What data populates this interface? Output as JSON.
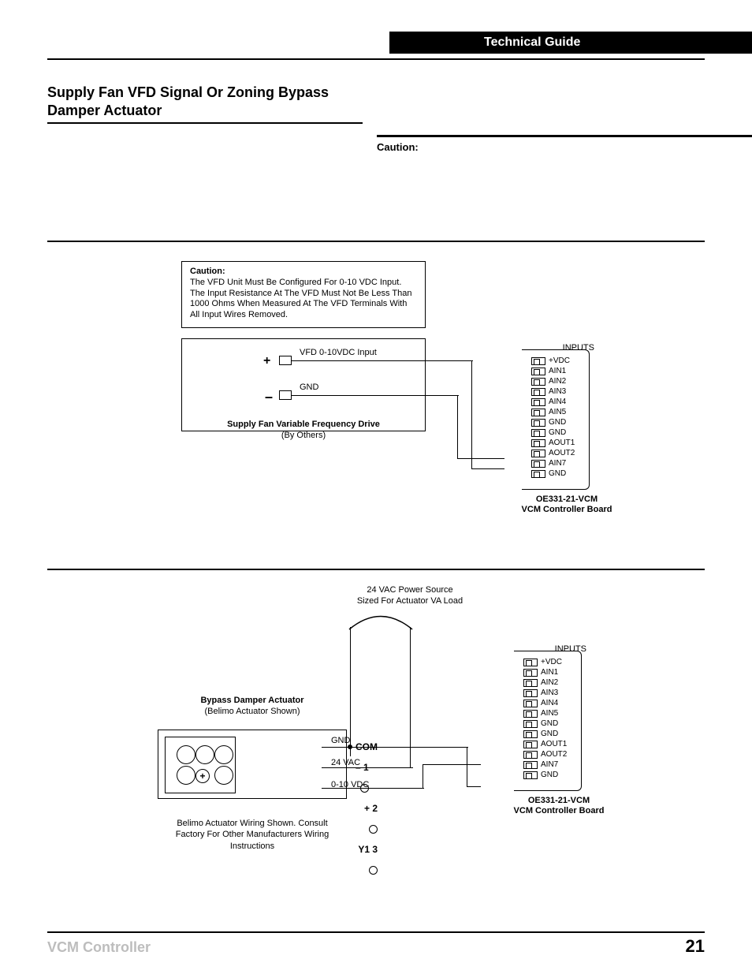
{
  "header": {
    "black_bar": "Technical Guide"
  },
  "section_title": "Supply Fan VFD Signal Or Zoning Bypass Damper Actuator",
  "caution_label": "Caution:",
  "diagram_a": {
    "caution_title": "Caution:",
    "caution_text": "The VFD Unit Must Be Configured For 0-10 VDC Input. The Input Resistance At The VFD Must Not Be Less Than 1000 Ohms When Measured At The VFD Terminals With All Input Wires Removed.",
    "vfd_input_label": "VFD 0-10VDC Input",
    "gnd_label": "GND",
    "vfd_block_title": "Supply Fan Variable Frequency Drive",
    "vfd_block_sub": "(By Others)",
    "plus": "+",
    "minus": "–",
    "board_inputs_label": "INPUTS",
    "board_terminals": [
      "+VDC",
      "AIN1",
      "AIN2",
      "AIN3",
      "AIN4",
      "AIN5",
      "GND",
      "GND",
      "AOUT1",
      "AOUT2",
      "AIN7",
      "GND"
    ],
    "board_caption_a": "OE331-21-VCM",
    "board_caption_b": "VCM Controller Board"
  },
  "diagram_b": {
    "power_label_a": "24 VAC Power Source",
    "power_label_b": "Sized For Actuator VA Load",
    "bypass_title": "Bypass Damper Actuator",
    "bypass_sub": "(Belimo  Actuator Shown)",
    "term1": "COM  –   1",
    "term2": "+   2",
    "term3": "Y1  3",
    "sig_gnd": "GND",
    "sig_24vac": "24 VAC",
    "sig_010": "0-10 VDC",
    "plus_center": "+",
    "board_inputs_label": "INPUTS",
    "board_terminals": [
      "+VDC",
      "AIN1",
      "AIN2",
      "AIN3",
      "AIN4",
      "AIN5",
      "GND",
      "GND",
      "AOUT1",
      "AOUT2",
      "AIN7",
      "GND"
    ],
    "board_caption_a": "OE331-21-VCM",
    "board_caption_b": "VCM Controller Board",
    "belimo_note": "Belimo Actuator Wiring Shown. Consult Factory For Other Manufacturers Wiring Instructions"
  },
  "footer": {
    "left": "VCM Controller",
    "page": "21"
  }
}
